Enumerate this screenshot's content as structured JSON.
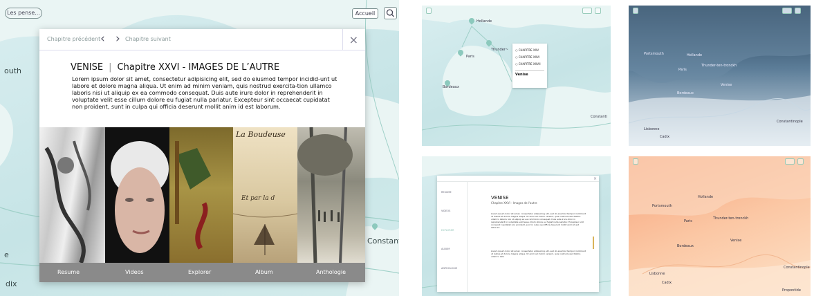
{
  "main": {
    "top_left_button": "Les pense...",
    "home_button": "Accueil",
    "map_label_south": "outh",
    "map_label_dix": "dix",
    "map_label_e": "e",
    "map_label_constanti": "Constanti",
    "nav_prev": "Chapitre précédent",
    "nav_next": "Chapitre suivant",
    "close": "×",
    "title_city": "VENISE",
    "title_divider": "|",
    "title_chapter": "Chapitre XXVI - IMAGES DE L’AUTRE",
    "body_text": "Lorem ipsum dolor sit amet, consectetur adipisicing elit, sed do eiusmod tempor incidid-unt ut labore et dolore magna aliqua. Ut enim ad minim veniam, quis nostrud exercita-tion ullamco laboris nisi ut aliquip ex ea commodo consequat. Duis aute irure dolor in reprehenderit in voluptate velit esse cillum dolore eu fugiat nulla pariatur. Excepteur sint occaecat cupidatat non proident, sunt in culpa qui officia deserunt mollit anim id est laborum.",
    "gallery_script_1": "La Boudeuse",
    "gallery_script_2": "Et par la d",
    "tabs": [
      "Resume",
      "Videos",
      "Explorer",
      "Album",
      "Anthologie"
    ]
  },
  "map_popup": {
    "places": [
      "Hollande",
      "Paris",
      "Thunder~",
      "Bordeaux",
      "Constanti"
    ],
    "options": [
      "CHAPITRE XXV",
      "CHAPITRE XXVI",
      "CHAPITRE XXVII"
    ],
    "selected_city": "Venise"
  },
  "blue_map": {
    "places": [
      "Portsmouth",
      "Hollande",
      "Paris",
      "Thunder-ten-tronckh",
      "Bordeaux",
      "Venise",
      "Lisbonne",
      "Cadix",
      "Constantinople"
    ]
  },
  "reading": {
    "menu": [
      "RESUME",
      "VIDEOS",
      "EXPLORER",
      "ALBUM",
      "ANTHOLOGIE"
    ],
    "title": "VENISE",
    "subtitle": "Chapitre XXVI - Images de l'autre",
    "para1": "Lorem ipsum dolor sit amet, consectetur adipisicing elit, sed do eiusmod tempor incididunt ut labore et dolore magna aliqua. Ut enim ad minim veniam, quis nostrud exercitation ullamco laboris nisi ut aliquip ex ea commodo consequat. Duis aute irure dolor in reprehenderit in voluptate velit esse cillum dolore eu fugiat nulla pariatur. Excepteur sint occaecat cupidatat non proident, sunt in culpa qui officia deserunt mollit anim id est laborum.",
    "para2": "Lorem ipsum dolor sit amet, consectetur adipisicing elit, sed do eiusmod tempor incididunt ut labore et dolore magna aliqua. Ut enim ad minim veniam, quis nostrud exercitation ullamco labo"
  },
  "orange_map": {
    "places": [
      "Portsmouth",
      "Hollande",
      "Paris",
      "Thunder-ten-tronckh",
      "Bordeaux",
      "Venise",
      "Lisbonne",
      "Cadix",
      "Constantinople",
      "Propontide"
    ]
  },
  "colors": {
    "sea": "#cfe9ea",
    "land": "#eef7f6",
    "accent": "#8cc9bd",
    "tabbar": "#8a8a8a",
    "orange": "#f6a47a",
    "navy": "#2c4258"
  }
}
